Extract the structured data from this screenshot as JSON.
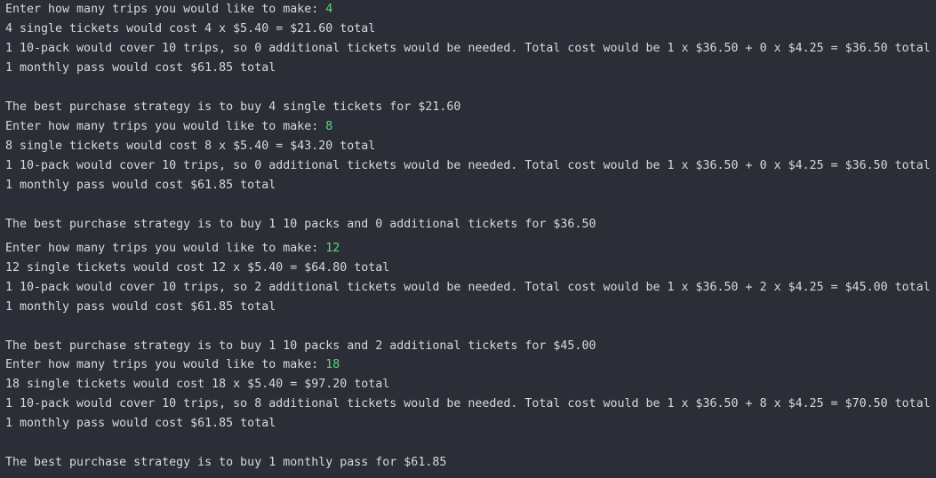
{
  "colors": {
    "background": "#2b2d37",
    "text": "#d8d9de",
    "user_input": "#5fd87a"
  },
  "runs": [
    {
      "prompt": "Enter how many trips you would like to make: ",
      "input": "4",
      "single": "4 single tickets would cost 4 x $5.40 = $21.60 total",
      "tenpack": "1 10-pack would cover 10 trips, so 0 additional tickets would be needed. Total cost would be 1 x $36.50 + 0 x $4.25 = $36.50 total",
      "monthly": "1 monthly pass would cost $61.85 total",
      "best": "The best purchase strategy is to buy 4 single tickets for $21.60"
    },
    {
      "prompt": "Enter how many trips you would like to make: ",
      "input": "8",
      "single": "8 single tickets would cost 8 x $5.40 = $43.20 total",
      "tenpack": "1 10-pack would cover 10 trips, so 0 additional tickets would be needed. Total cost would be 1 x $36.50 + 0 x $4.25 = $36.50 total",
      "monthly": "1 monthly pass would cost $61.85 total",
      "best": "The best purchase strategy is to buy 1 10 packs and 0 additional tickets for $36.50"
    },
    {
      "prompt": "Enter how many trips you would like to make: ",
      "input": "12",
      "single": "12 single tickets would cost 12 x $5.40 = $64.80 total",
      "tenpack": "1 10-pack would cover 10 trips, so 2 additional tickets would be needed. Total cost would be 1 x $36.50 + 2 x $4.25 = $45.00 total",
      "monthly": "1 monthly pass would cost $61.85 total",
      "best": "The best purchase strategy is to buy 1 10 packs and 2 additional tickets for $45.00"
    },
    {
      "prompt": "Enter how many trips you would like to make: ",
      "input": "18",
      "single": "18 single tickets would cost 18 x $5.40 = $97.20 total",
      "tenpack": "1 10-pack would cover 10 trips, so 8 additional tickets would be needed. Total cost would be 1 x $36.50 + 8 x $4.25 = $70.50 total",
      "monthly": "1 monthly pass would cost $61.85 total",
      "best": "The best purchase strategy is to buy 1 monthly pass for $61.85"
    }
  ]
}
